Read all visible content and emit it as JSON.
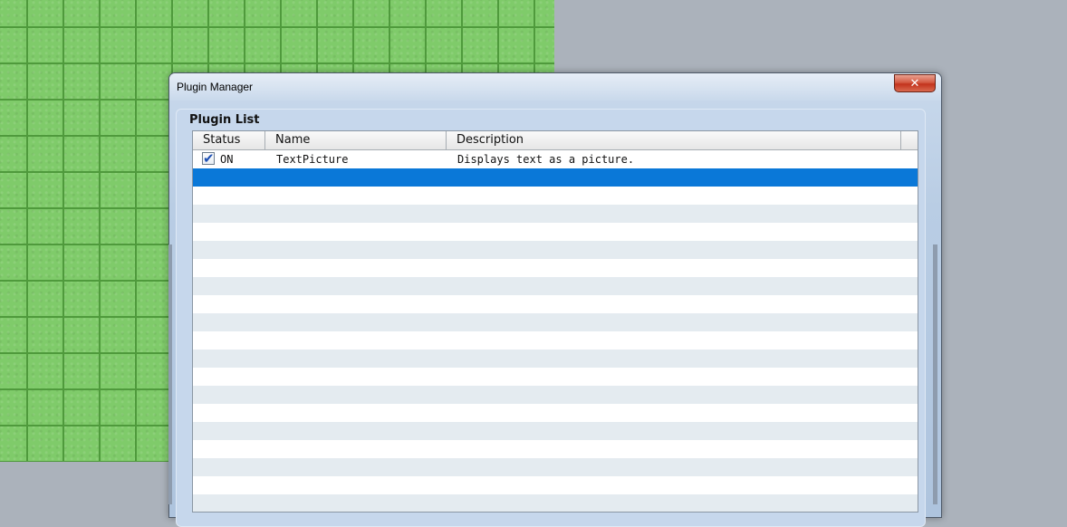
{
  "window": {
    "title": "Plugin Manager",
    "close_symbol": "✕"
  },
  "plugin_list": {
    "group_label": "Plugin List",
    "columns": [
      "Status",
      "Name",
      "Description"
    ],
    "rows": [
      {
        "checked": true,
        "status": "ON",
        "name": "TextPicture",
        "description": "Displays text as a picture."
      }
    ],
    "selected_row_index": 1
  },
  "colors": {
    "selection": "#0a78d8",
    "map_grass": "#7fcb6a",
    "stripe": "#e4ebf0"
  }
}
